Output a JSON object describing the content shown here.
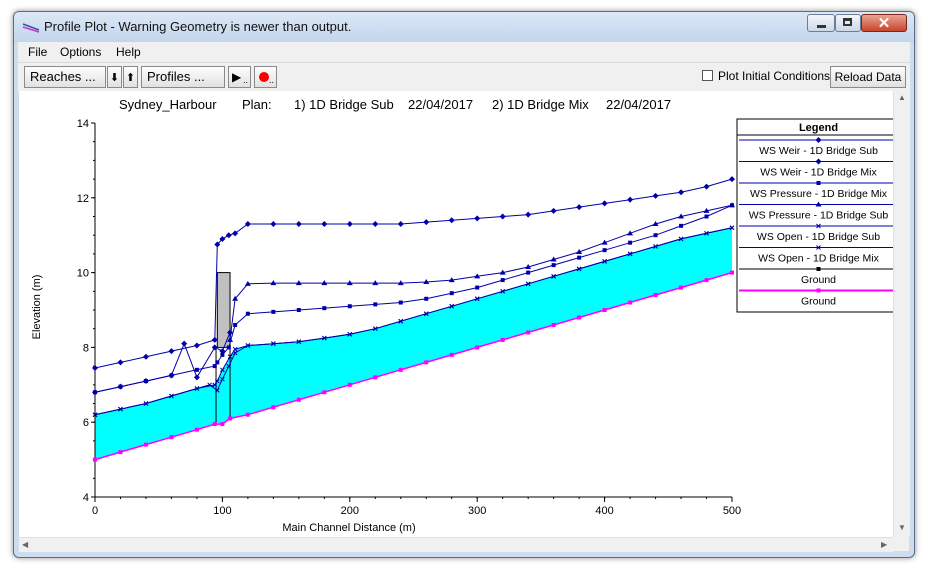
{
  "window": {
    "title": "Profile Plot - Warning Geometry is newer than output.",
    "minimize_label": "",
    "maximize_label": "",
    "close_label": "✕"
  },
  "menu": {
    "file": "File",
    "options": "Options",
    "help": "Help"
  },
  "toolbar": {
    "reaches_label": "Reaches ...",
    "profiles_label": "Profiles ...",
    "down_arrow": "⬇",
    "up_arrow": "⬆",
    "play_label": "▶",
    "dots_play": "..",
    "dots_record": "..",
    "plot_initial_conditions": "Plot Initial Conditions",
    "plot_initial_conditions_checked": false,
    "reload_label": "Reload Data"
  },
  "colors": {
    "water_fill": "#00ffff",
    "ws_line": "#0000aa",
    "ground": "#ff00ff",
    "bridge_deck": "#c0c0c0",
    "record_dot": "#ff0000"
  },
  "chart_data": {
    "type": "line",
    "header": {
      "project": "Sydney_Harbour",
      "plan_label": "Plan:",
      "plan1": "1) 1D Bridge Sub",
      "date1": "22/04/2017",
      "plan2": "2) 1D Bridge Mix",
      "date2": "22/04/2017"
    },
    "xlabel": "Main Channel Distance (m)",
    "ylabel": "Elevation (m)",
    "xlim": [
      0,
      500
    ],
    "ylim": [
      4,
      14
    ],
    "x_ticks": [
      0,
      100,
      200,
      300,
      400,
      500
    ],
    "y_ticks": [
      4,
      6,
      8,
      10,
      12,
      14
    ],
    "legend": {
      "title": "Legend",
      "placement": "right",
      "entries": [
        "WS  Weir - 1D Bridge Sub",
        "WS  Weir - 1D Bridge Mix",
        "WS  Pressure - 1D Bridge Mix",
        "WS  Pressure - 1D Bridge Sub",
        "WS  Open - 1D Bridge Sub",
        "WS  Open - 1D Bridge Mix",
        "Ground",
        "Ground"
      ]
    },
    "bridge": {
      "x_start": 95,
      "x_end": 106,
      "low_chord": 8.0,
      "high_chord": 10.0
    },
    "series": [
      {
        "name": "WS  Weir - 1D Bridge Sub",
        "marker": "diamond",
        "x": [
          0,
          20,
          40,
          60,
          80,
          94,
          96,
          100,
          105,
          110,
          120,
          140,
          160,
          180,
          200,
          220,
          240,
          260,
          280,
          300,
          320,
          340,
          360,
          380,
          400,
          420,
          440,
          460,
          480,
          500
        ],
        "y": [
          7.45,
          7.6,
          7.75,
          7.9,
          8.05,
          8.2,
          10.75,
          10.9,
          11.0,
          11.05,
          11.3,
          11.3,
          11.3,
          11.3,
          11.3,
          11.3,
          11.3,
          11.35,
          11.4,
          11.45,
          11.5,
          11.55,
          11.65,
          11.75,
          11.85,
          11.95,
          12.05,
          12.15,
          12.3,
          12.5
        ]
      },
      {
        "name": "WS  Pressure - 1D Bridge Mix",
        "marker": "square",
        "x": [
          0,
          20,
          40,
          60,
          80,
          94,
          96,
          100,
          105,
          110,
          120,
          140,
          160,
          180,
          200,
          220,
          240,
          260,
          280,
          300,
          320,
          340,
          360,
          380,
          400,
          420,
          440,
          460,
          480,
          500
        ],
        "y": [
          6.8,
          6.95,
          7.1,
          7.25,
          7.4,
          7.5,
          7.6,
          7.8,
          8.0,
          8.6,
          8.9,
          8.95,
          9.0,
          9.05,
          9.1,
          9.15,
          9.2,
          9.3,
          9.45,
          9.6,
          9.8,
          10.0,
          10.2,
          10.4,
          10.6,
          10.8,
          11.0,
          11.25,
          11.5,
          11.8
        ]
      },
      {
        "name": "WS  Pressure - 1D Bridge Sub",
        "marker": "triangle",
        "x": [
          106,
          110,
          120,
          140,
          160,
          180,
          200,
          220,
          240,
          260,
          280,
          300,
          320,
          340,
          360,
          380,
          400,
          420,
          440,
          460,
          480,
          500
        ],
        "y": [
          8.2,
          9.3,
          9.7,
          9.72,
          9.72,
          9.72,
          9.72,
          9.72,
          9.72,
          9.75,
          9.8,
          9.9,
          10.0,
          10.15,
          10.35,
          10.55,
          10.8,
          11.05,
          11.3,
          11.5,
          11.65,
          11.8
        ]
      },
      {
        "name": "WS  Open - 1D Bridge Sub",
        "marker": "x",
        "x": [
          0,
          20,
          40,
          60,
          80,
          94,
          96,
          100,
          106,
          110,
          120,
          140,
          160,
          180,
          200,
          220,
          240,
          260,
          280,
          300,
          320,
          340,
          360,
          380,
          400,
          420,
          440,
          460,
          480,
          500
        ],
        "y": [
          6.2,
          6.35,
          6.5,
          6.7,
          6.9,
          7.0,
          7.1,
          7.4,
          7.75,
          7.95,
          8.05,
          8.1,
          8.15,
          8.25,
          8.35,
          8.5,
          8.7,
          8.9,
          9.1,
          9.3,
          9.5,
          9.7,
          9.9,
          10.1,
          10.3,
          10.5,
          10.7,
          10.9,
          11.05,
          11.2
        ]
      },
      {
        "name": "WS  Open - 1D Bridge Mix",
        "marker": "x",
        "x": [
          0,
          20,
          40,
          60,
          80,
          90,
          96,
          100,
          105,
          110,
          120,
          140,
          160,
          180,
          200,
          220,
          240,
          260,
          280,
          300,
          320,
          340,
          360,
          380,
          400,
          420,
          440,
          460,
          480,
          500
        ],
        "y": [
          6.2,
          6.35,
          6.5,
          6.7,
          6.9,
          7.0,
          6.85,
          7.15,
          7.5,
          7.85,
          8.05,
          8.1,
          8.15,
          8.25,
          8.35,
          8.5,
          8.7,
          8.9,
          9.1,
          9.3,
          9.5,
          9.7,
          9.9,
          10.1,
          10.3,
          10.5,
          10.7,
          10.9,
          11.05,
          11.2
        ]
      },
      {
        "name": "WS  Weir - 1D Bridge Mix",
        "marker": "diamond",
        "x": [
          0,
          20,
          40,
          60,
          70,
          80,
          94,
          100,
          106
        ],
        "y": [
          6.8,
          6.95,
          7.1,
          7.25,
          8.1,
          7.2,
          8.0,
          7.9,
          8.4
        ]
      },
      {
        "name": "Ground",
        "marker": "square",
        "x": [
          0,
          20,
          40,
          60,
          80,
          94,
          100,
          106,
          120,
          140,
          160,
          180,
          200,
          220,
          240,
          260,
          280,
          300,
          320,
          340,
          360,
          380,
          400,
          420,
          440,
          460,
          480,
          500
        ],
        "y": [
          5.0,
          5.2,
          5.4,
          5.6,
          5.8,
          5.95,
          5.95,
          6.1,
          6.2,
          6.4,
          6.6,
          6.8,
          7.0,
          7.2,
          7.4,
          7.6,
          7.8,
          8.0,
          8.2,
          8.4,
          8.6,
          8.8,
          9.0,
          9.2,
          9.4,
          9.6,
          9.8,
          10.0
        ]
      }
    ]
  }
}
